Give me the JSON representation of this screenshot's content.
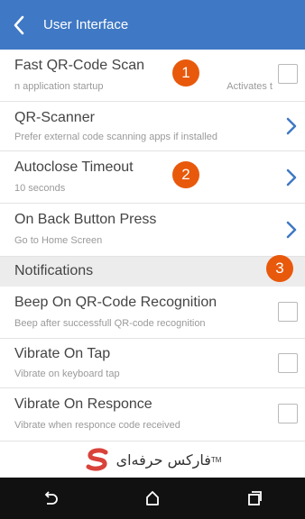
{
  "appbar": {
    "title": "User Interface",
    "back_icon": "chevron-left-icon"
  },
  "settings": [
    {
      "title": "Fast QR-Code Scan",
      "subtitle": "n application startup",
      "aside": "Activates t",
      "control": "checkbox"
    },
    {
      "title": "QR-Scanner",
      "subtitle": "Prefer external code scanning apps if installed",
      "control": "chevron"
    },
    {
      "title": "Autoclose Timeout",
      "subtitle": "10 seconds",
      "control": "chevron"
    },
    {
      "title": "On Back Button Press",
      "subtitle": "Go to Home Screen",
      "control": "chevron"
    }
  ],
  "section": {
    "label": "Notifications"
  },
  "notifications": [
    {
      "title": "Beep On QR-Code Recognition",
      "subtitle": "Beep after successfull QR-code recognition",
      "control": "checkbox"
    },
    {
      "title": "Vibrate On Tap",
      "subtitle": "Vibrate on keyboard tap",
      "control": "checkbox"
    },
    {
      "title": "Vibrate On Responce",
      "subtitle": "Vibrate when responce code received",
      "control": "checkbox"
    }
  ],
  "badges": [
    "1",
    "2",
    "3"
  ],
  "brand": {
    "name": "فارکس حرفه‌ای",
    "trademark": "TM"
  },
  "navbar": {
    "back_icon": "back-icon",
    "home_icon": "home-icon",
    "recents_icon": "recents-icon"
  },
  "colors": {
    "appbar": "#3f78c4",
    "accent": "#3f78c4",
    "badge": "#e8590c",
    "section_bg": "#ececec",
    "navbar": "#111111"
  }
}
